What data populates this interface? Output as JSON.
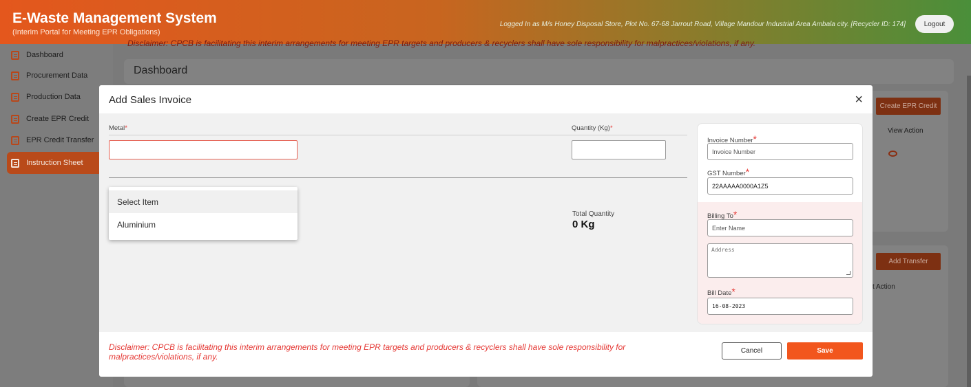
{
  "header": {
    "title": "E-Waste Management System",
    "subtitle": "(Interim Portal for Meeting EPR Obligations)",
    "login_info": "Logged In as M/s Honey Disposal Store, Plot No. 67-68 Jarrout Road, Village Mandour Industrial Area Ambala city. [Recycler ID: 174]",
    "logout_label": "Logout"
  },
  "sidebar": {
    "items": [
      {
        "label": "Dashboard",
        "icon": "document-edit-icon"
      },
      {
        "label": "Procurement Data",
        "icon": "document-edit-icon"
      },
      {
        "label": "Production Data",
        "icon": "document-edit-icon"
      },
      {
        "label": "Create EPR Credit",
        "icon": "document-edit-icon"
      },
      {
        "label": "EPR Credit Transfer",
        "icon": "document-edit-icon"
      },
      {
        "label": "Instruction Sheet",
        "icon": "document-edit-icon",
        "active": true
      }
    ]
  },
  "background": {
    "disclaimer": "Disclaimer: CPCB is facilitating this interim arrangements for meeting EPR targets and producers & recyclers shall have sole responsibility for malpractices/violations, if any.",
    "page_title": "Dashboard",
    "create_credit_button": "Create EPR Credit",
    "view_action_header": "View Action",
    "add_transfer_button": "Add Transfer",
    "action_header": "t Action"
  },
  "modal": {
    "title": "Add Sales Invoice",
    "metal_label": "Metal",
    "quantity_label": "Quantity (Kg)",
    "metal_options": [
      "Select Item",
      "Aluminium"
    ],
    "total_quantity_label": "Total Quantity",
    "total_quantity_value": "0 Kg",
    "invoice_number_label": "Invoice Number",
    "invoice_number_placeholder": "Invoice Number",
    "gst_number_label": "GST Number",
    "gst_number_value": "22AAAAA0000A1Z5",
    "billing_to_label": "Billing To",
    "billing_name_placeholder": "Enter Name",
    "address_placeholder": "Address",
    "bill_date_label": "Bill Date",
    "bill_date_value": "16-08-2023",
    "disclaimer": "Disclaimer: CPCB is facilitating this interim arrangements for meeting EPR targets and producers & recyclers shall have sole responsibility for malpractices/violations, if any.",
    "cancel_label": "Cancel",
    "save_label": "Save"
  },
  "colors": {
    "accent": "#f2561d",
    "required": "#e53935",
    "header_start": "#e4571d",
    "header_end": "#4a8f3a"
  }
}
